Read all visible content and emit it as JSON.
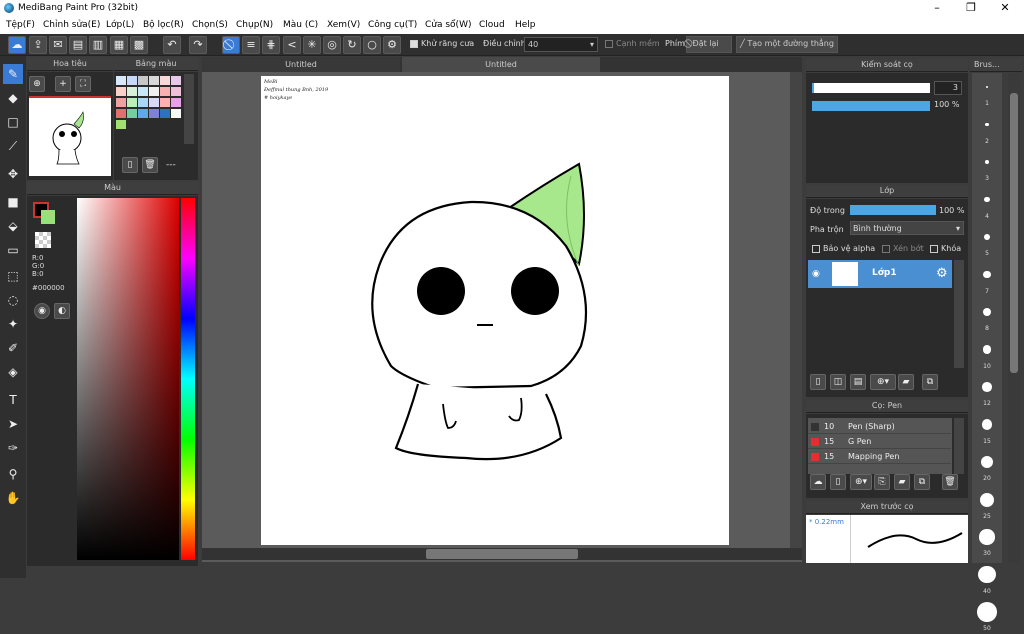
{
  "app": {
    "title": "MediBang Paint Pro (32bit)"
  },
  "menu": [
    "Tệp(F)",
    "Chỉnh sửa(E)",
    "Lớp(L)",
    "Bộ lọc(R)",
    "Chọn(S)",
    "Chụp(N)",
    "Màu (C)",
    "Xem(V)",
    "Công cụ(T)",
    "Cửa sổ(W)",
    "Cloud",
    "Help"
  ],
  "toolbar": {
    "antialias_label": "Khử răng cưa",
    "adjust_label": "Điều chỉnh",
    "adjust_value": "40",
    "smooth_label": "Cạnh mềm",
    "key_label": "Phím",
    "reset_label": "Đặt lại",
    "straight_label": "Tạo một đường thẳng"
  },
  "panels": {
    "nav": "Hoa tiêu",
    "palette": "Bảng màu",
    "color": "Màu",
    "brush_control": "Kiểm soát cọ",
    "layer": "Lớp",
    "brush": "Cọ: Pen",
    "brush_preview": "Xem trước cọ",
    "brush_size_panel": "Brus..."
  },
  "color": {
    "current": "#000000",
    "r": "R:0",
    "g": "G:0",
    "b": "B:0",
    "hex": "#000000"
  },
  "palette_dash": "---",
  "tabs": [
    "Untitled",
    "Untitled"
  ],
  "canvas_note": [
    "MeBi",
    "Đeffmul thung Bnh, 2019",
    "# hoiykaye"
  ],
  "brush_control": {
    "size": "3",
    "opacity": "100 %",
    "size_fill": 0.02,
    "opacity_fill": 1.0
  },
  "layer": {
    "opacity_label": "Độ trong",
    "opacity_value": "100 %",
    "blend_label": "Pha trộn",
    "blend_value": "Bình thường",
    "protect_alpha": "Bảo vệ alpha",
    "clip": "Xén bớt",
    "lock": "Khóa",
    "name": "Lớp1"
  },
  "brushes": [
    {
      "size": "10",
      "name": "Pen (Sharp)",
      "color": "#333333"
    },
    {
      "size": "15",
      "name": "G Pen",
      "color": "#e03030"
    },
    {
      "size": "15",
      "name": "Mapping Pen",
      "color": "#e03030"
    }
  ],
  "preview": {
    "size": "* 0.22mm"
  },
  "brush_sizes": [
    "1",
    "2",
    "3",
    "4",
    "5",
    "7",
    "8",
    "10",
    "12",
    "15",
    "20",
    "25",
    "30",
    "40",
    "50"
  ]
}
